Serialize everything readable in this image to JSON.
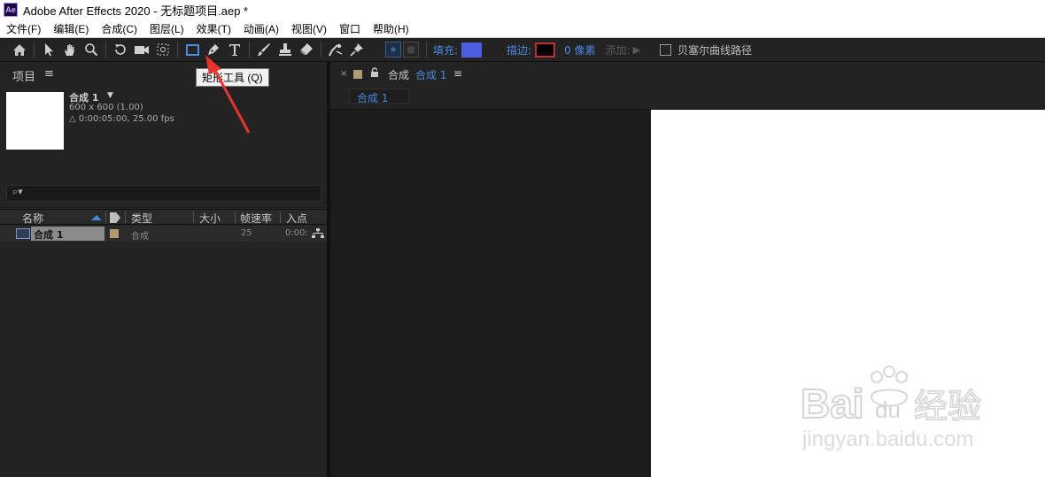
{
  "titlebar": {
    "logo": "Ae",
    "title": "Adobe After Effects 2020 - 无标题项目.aep *"
  },
  "menu": [
    "文件(F)",
    "编辑(E)",
    "合成(C)",
    "图层(L)",
    "效果(T)",
    "动画(A)",
    "视图(V)",
    "窗口",
    "帮助(H)"
  ],
  "toolbar": {
    "fill_label": "填充:",
    "stroke_label": "描边:",
    "stroke_width": "0 像素",
    "add_label": "添加:",
    "bezier_label": "贝塞尔曲线路径",
    "fill_color": "#4d5fe0",
    "stroke_color": "#c0302f",
    "tools": [
      "home-icon",
      "selection-icon",
      "hand-icon",
      "zoom-icon",
      "rotate-icon",
      "camera-icon",
      "pan-behind-icon",
      "rectangle-icon",
      "pen-icon",
      "type-icon",
      "brush-icon",
      "clone-stamp-icon",
      "eraser-icon",
      "roto-brush-icon",
      "puppet-pin-icon"
    ]
  },
  "tooltip": {
    "text": "矩形工具 (Q)"
  },
  "project": {
    "panel_title": "项目",
    "panel_menu": "≡",
    "comp_name": "合成 1",
    "comp_dims": "600 x 600 (1.00)",
    "comp_duration": "△ 0:00:05:00, 25.00 fps",
    "search_icon": "⌕▾",
    "columns": {
      "name": "名称",
      "type": "类型",
      "size": "大小",
      "fps": "帧速率",
      "in": "入点"
    },
    "rows": [
      {
        "name": "合成 1",
        "type": "合成",
        "fps": "25",
        "in": "0:00:"
      }
    ]
  },
  "composition": {
    "close": "×",
    "tab_label": "合成",
    "tab_name": "合成 1",
    "tab_menu": "≡",
    "breadcrumb": "合成 1"
  },
  "watermark": {
    "brand": "Bai",
    "du": "du",
    "sub": "经验",
    "url": "jingyan.baidu.com"
  }
}
